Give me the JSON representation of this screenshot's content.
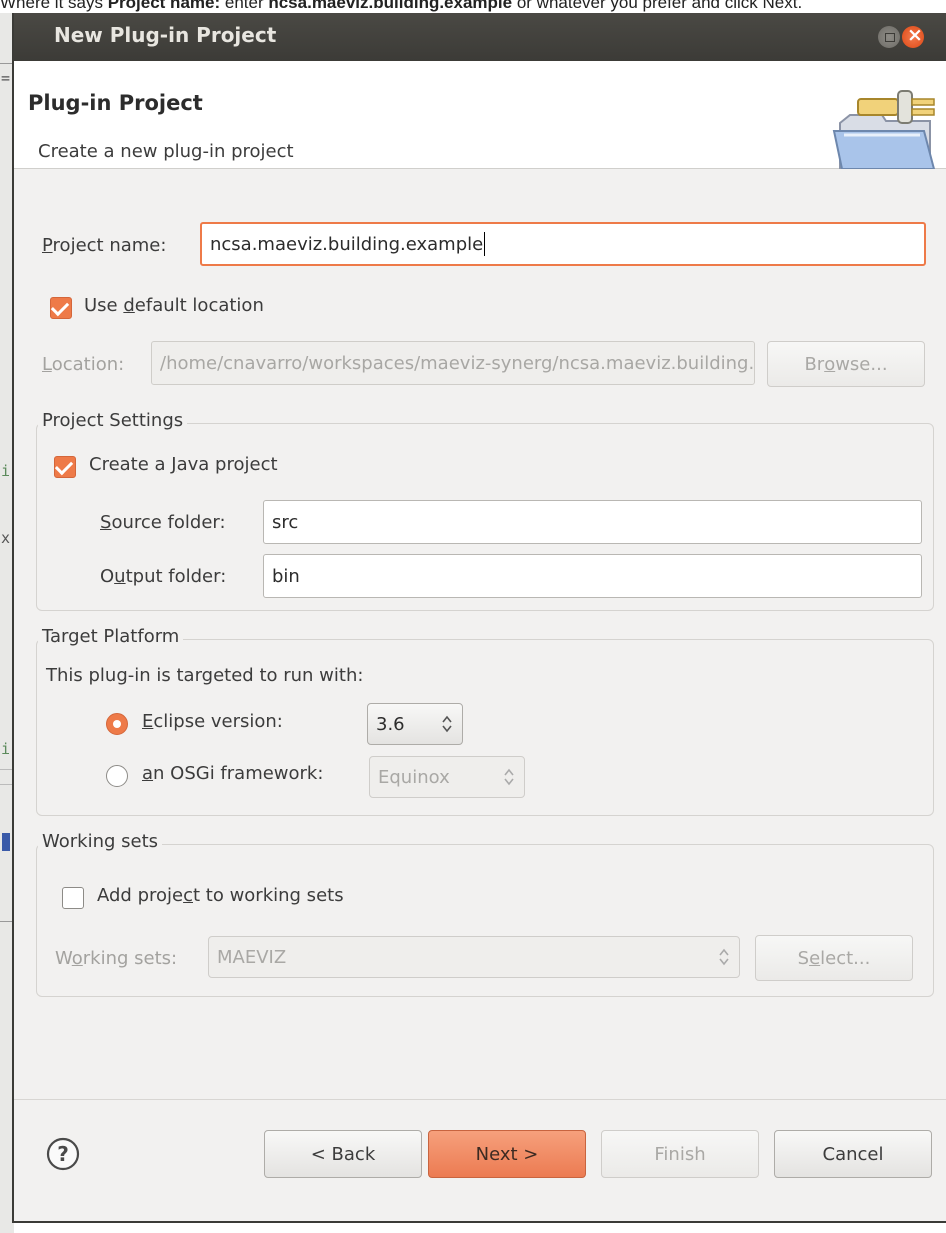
{
  "caption": {
    "p1": "Where it says ",
    "b1": "Project name:",
    "p2": " enter ",
    "b2": "ncsa.maeviz.building.example",
    "p3": " or whatever you prefer and click Next."
  },
  "window": {
    "title": "New Plug-in Project"
  },
  "header": {
    "title": "Plug-in Project",
    "description": "Create a new plug-in project",
    "icon": "plugin-folder-icon"
  },
  "project_name": {
    "label_pre": "",
    "label_mn": "P",
    "label_post": "roject name:",
    "value": "ncsa.maeviz.building.example"
  },
  "use_default_location": {
    "checked": true,
    "label_pre": "Use ",
    "label_mn": "d",
    "label_post": "efault location"
  },
  "location": {
    "label_pre": "",
    "label_mn": "L",
    "label_post": "ocation:",
    "value": "/home/cnavarro/workspaces/maeviz-synerg/ncsa.maeviz.building.example",
    "browse_pre": "Br",
    "browse_mn": "o",
    "browse_post": "wse..."
  },
  "project_settings": {
    "title": "Project Settings",
    "create_java": {
      "checked": true,
      "label_pre": "Create a ",
      "label_mn": "J",
      "label_post": "ava project"
    },
    "source": {
      "label_pre": "",
      "label_mn": "S",
      "label_post": "ource folder:",
      "value": "src"
    },
    "output": {
      "label_pre": "O",
      "label_mn": "u",
      "label_post": "tput folder:",
      "value": "bin"
    }
  },
  "target_platform": {
    "title": "Target Platform",
    "intro": "This plug-in is targeted to run with:",
    "eclipse": {
      "selected": true,
      "label_pre": "",
      "label_mn": "E",
      "label_post": "clipse version:",
      "value": "3.6"
    },
    "osgi": {
      "selected": false,
      "label_pre": "",
      "label_mn": "a",
      "label_post": "n OSGi framework:",
      "value": "Equinox"
    }
  },
  "working_sets": {
    "title": "Working sets",
    "add": {
      "checked": false,
      "label_pre": "Add proje",
      "label_mn": "c",
      "label_post": "t to working sets"
    },
    "sets": {
      "label_pre": "W",
      "label_mn": "o",
      "label_post": "rking sets:",
      "value": "MAEVIZ"
    },
    "select_pre": "S",
    "select_mn": "e",
    "select_post": "lect..."
  },
  "footer": {
    "back": "< Back",
    "next": "Next >",
    "finish": "Finish",
    "cancel": "Cancel"
  },
  "colors": {
    "accent": "#ee7a48",
    "titlebar": "#3c3b37",
    "window_bg": "#f2f1f0"
  }
}
